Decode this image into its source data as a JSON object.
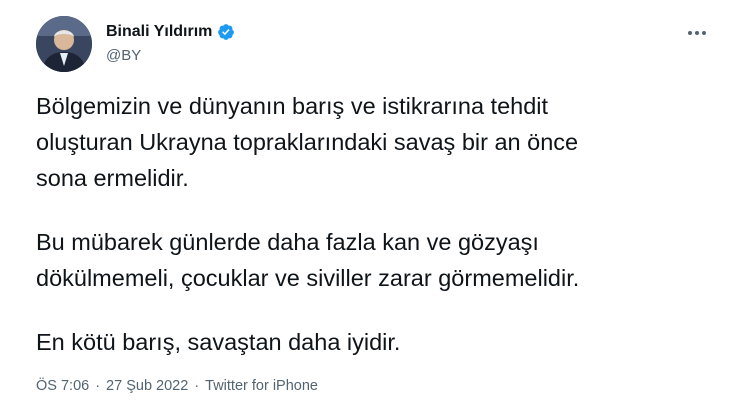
{
  "author": {
    "display_name": "Binali Yıldırım",
    "handle": "@BY",
    "verified_badge_icon": "verified-badge-icon",
    "verified_color": "#1d9bf0"
  },
  "tweet": {
    "paragraphs": [
      [
        "Bölgemizin ve dünyanın barış ve istikrarına tehdit",
        "oluşturan Ukrayna topraklarındaki savaş bir an önce",
        "sona ermelidir."
      ],
      [
        "Bu mübarek günlerde daha fazla kan ve gözyaşı",
        "dökülmemeli, çocuklar ve siviller zarar görmemelidir."
      ],
      [
        "En kötü barış, savaştan daha iyidir."
      ]
    ]
  },
  "meta": {
    "time": "ÖS 7:06",
    "separator": "·",
    "date": "27 Şub 2022",
    "source": "Twitter for iPhone"
  },
  "more_icon": "more-horizontal-icon"
}
